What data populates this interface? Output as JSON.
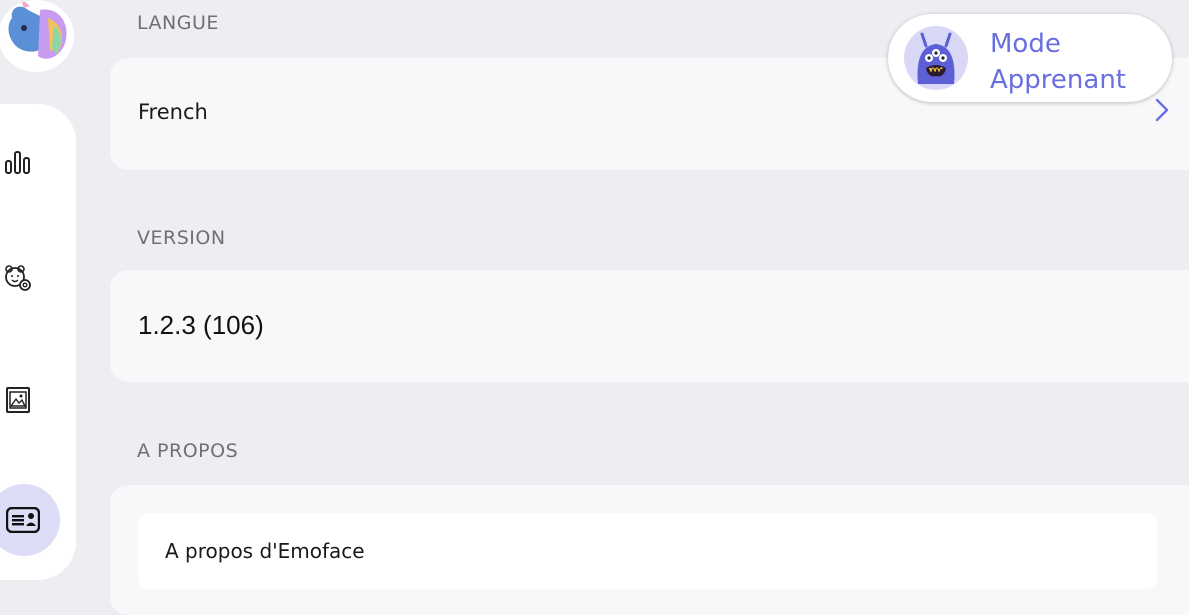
{
  "sidebar": {
    "items": [
      {
        "icon": "bar-chart-icon"
      },
      {
        "icon": "child-settings-icon"
      },
      {
        "icon": "image-icon"
      },
      {
        "icon": "id-card-icon",
        "active": true
      }
    ]
  },
  "sections": {
    "language": {
      "title": "LANGUE",
      "value": "French"
    },
    "version": {
      "title": "VERSION",
      "value": "1.2.3 (106)"
    },
    "about": {
      "title": "A PROPOS",
      "item": "A propos d'Emoface"
    }
  },
  "mode": {
    "line1": "Mode",
    "line2": "Apprenant"
  },
  "colors": {
    "accent": "#6a6fe0",
    "background": "#eeedf2",
    "card": "#f8f8fa",
    "active_nav": "#dcdcf7"
  }
}
